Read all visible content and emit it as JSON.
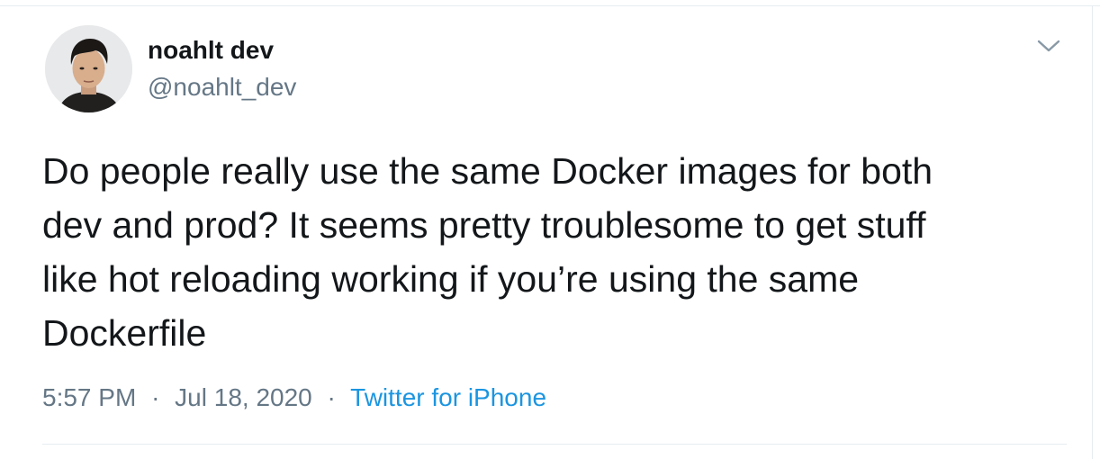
{
  "tweet": {
    "author": {
      "display_name": "noahlt dev",
      "handle": "@noahlt_dev"
    },
    "text": "Do people really use the same Docker images for both\ndev and prod? It seems pretty troublesome to get stuff\nlike hot reloading working if you’re using the same\nDockerfile",
    "meta": {
      "time": "5:57 PM",
      "separator": "·",
      "date": "Jul 18, 2020",
      "source": "Twitter for iPhone"
    }
  },
  "colors": {
    "text_primary": "#14171a",
    "text_secondary": "#657786",
    "link": "#1b95e0",
    "divider": "#e6ecf0"
  },
  "icons": {
    "menu": "chevron-down-icon",
    "avatar": "avatar"
  }
}
